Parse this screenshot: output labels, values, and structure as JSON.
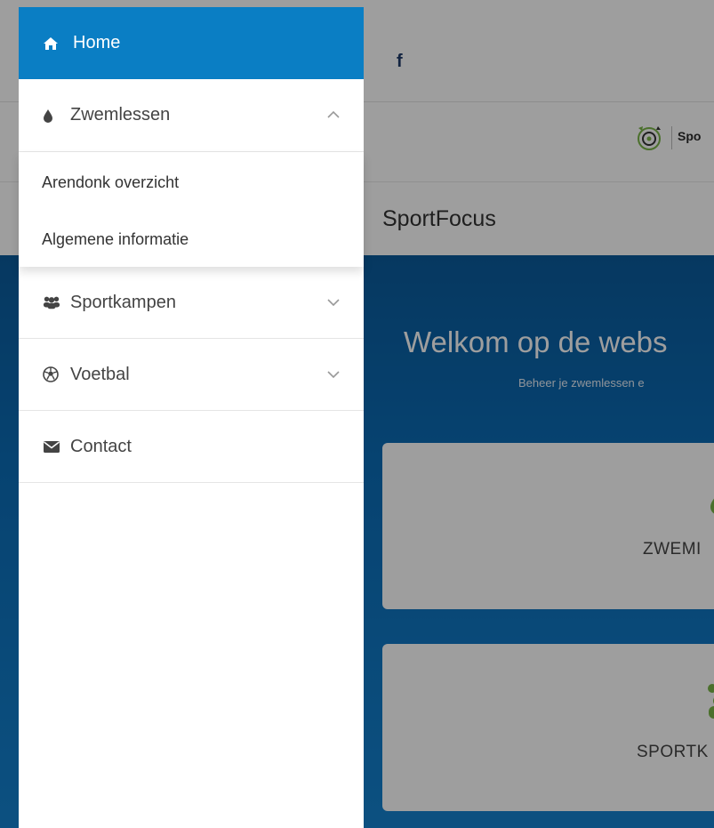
{
  "nav": {
    "home": "Home",
    "zwemlessen": "Zwemlessen",
    "zwemlessen_sub": [
      "Arendonk overzicht",
      "Algemene informatie"
    ],
    "sportkampen": "Sportkampen",
    "voetbal": "Voetbal",
    "contact": "Contact"
  },
  "page": {
    "social_icon": "f",
    "logo_text": "Spo",
    "brand": "SportFocus",
    "hero_title": "Welkom op de webs",
    "hero_subtitle": "Beheer je zwemlessen e",
    "cards": [
      "ZWEMI",
      "SPORTK"
    ]
  },
  "colors": {
    "primary": "#0a7ec4",
    "green": "#7ab547"
  }
}
